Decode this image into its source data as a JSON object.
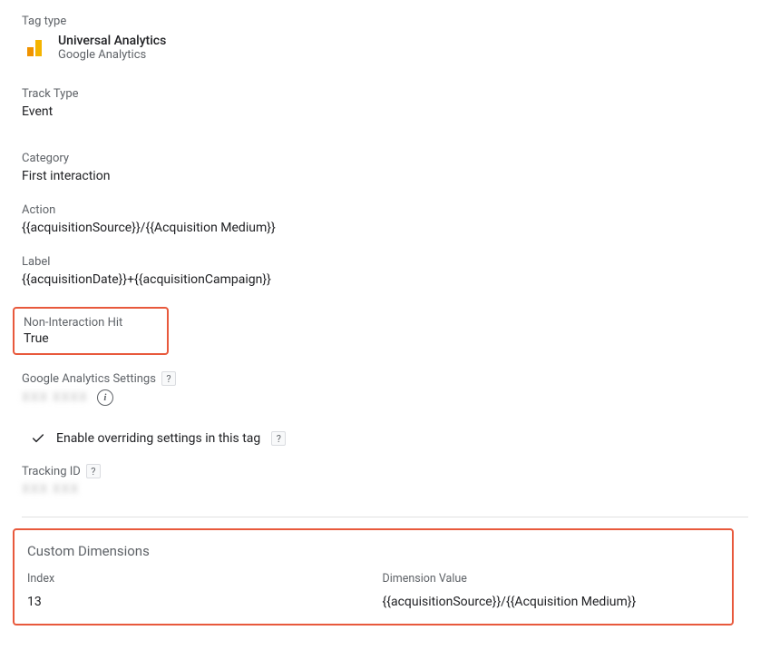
{
  "tag_type": {
    "section_label": "Tag type",
    "title": "Universal Analytics",
    "subtitle": "Google Analytics"
  },
  "track_type": {
    "label": "Track Type",
    "value": "Event"
  },
  "category": {
    "label": "Category",
    "value": "First interaction"
  },
  "action": {
    "label": "Action",
    "value": "{{acquisitionSource}}/{{Acquisition Medium}}"
  },
  "label": {
    "label": "Label",
    "value": "{{acquisitionDate}}+{{acquisitionCampaign}}"
  },
  "non_interaction": {
    "label": "Non-Interaction Hit",
    "value": "True"
  },
  "ga_settings": {
    "label": "Google Analytics Settings",
    "help": "?",
    "value_masked": "XXX XXXX",
    "info_glyph": "i"
  },
  "override": {
    "text": "Enable overriding settings in this tag",
    "help": "?"
  },
  "tracking_id": {
    "label": "Tracking ID",
    "help": "?",
    "value_masked": "XXX  XXX"
  },
  "custom_dimensions": {
    "heading": "Custom Dimensions",
    "columns": {
      "index": "Index",
      "value": "Dimension Value"
    },
    "rows": [
      {
        "index": "13",
        "value": "{{acquisitionSource}}/{{Acquisition Medium}}"
      }
    ]
  }
}
